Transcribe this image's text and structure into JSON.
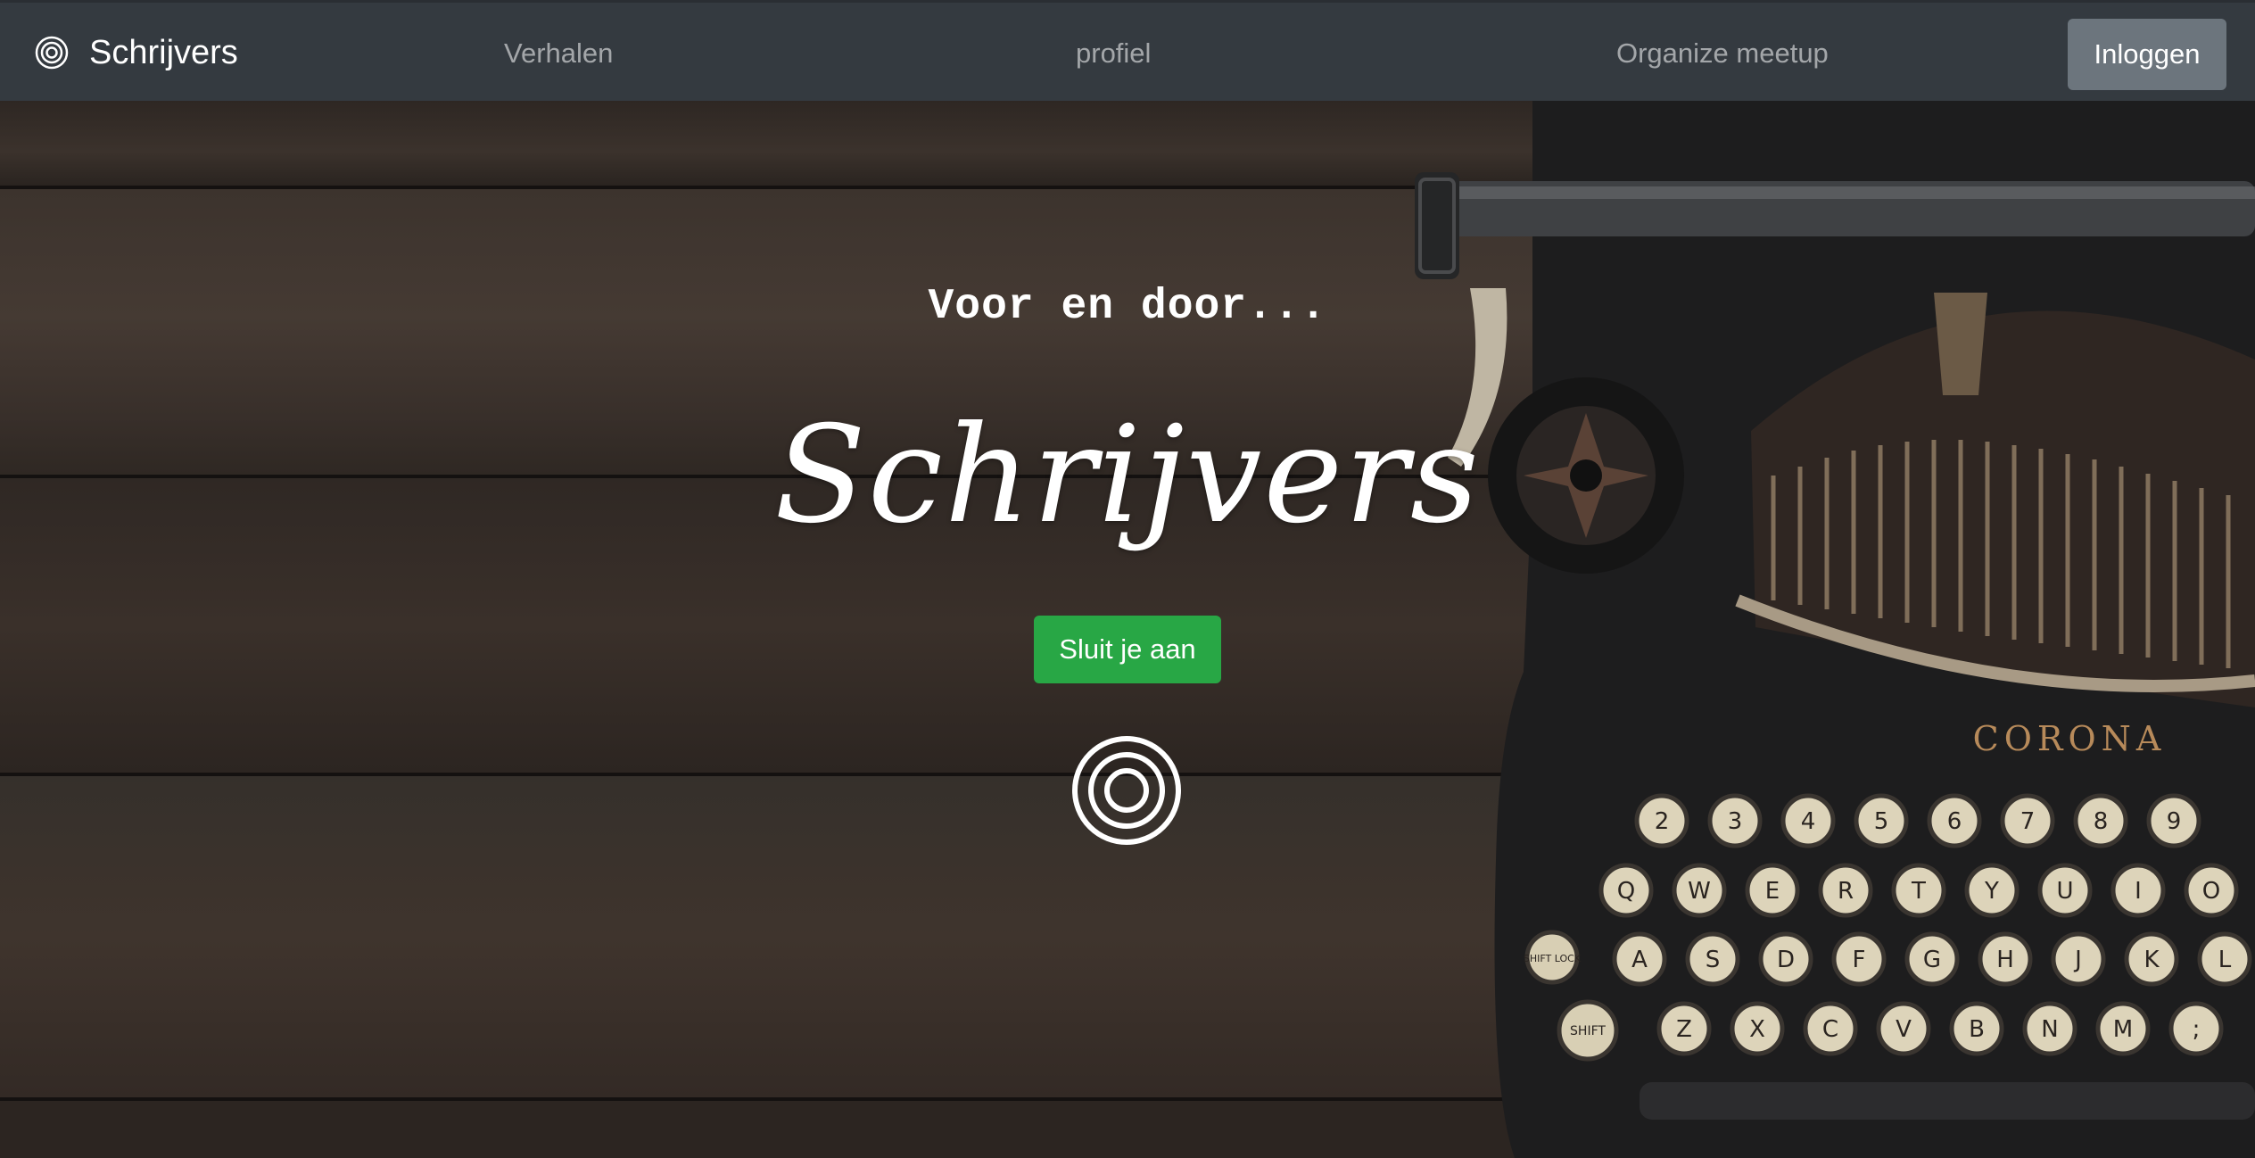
{
  "navbar": {
    "brand": "Schrijvers",
    "links": [
      "Verhalen",
      "profiel",
      "Organize meetup"
    ],
    "login_label": "Inloggen"
  },
  "hero": {
    "tagline": "Voor en door...",
    "title": "Schrijvers",
    "cta_label": "Sluit je aan",
    "typewriter_brand": "CORONA",
    "keys": {
      "number_row": [
        "2",
        "3",
        "4",
        "5",
        "6",
        "7",
        "8",
        "9"
      ],
      "top_row": [
        "Q",
        "W",
        "E",
        "R",
        "T",
        "Y",
        "U",
        "I",
        "O"
      ],
      "home_row": [
        "A",
        "S",
        "D",
        "F",
        "G",
        "H",
        "J",
        "K",
        "L"
      ],
      "bottom_row": [
        "Z",
        "X",
        "C",
        "V",
        "B",
        "N",
        "M",
        ";"
      ],
      "shift_lock": "SHIFT LOCK",
      "shift": "SHIFT"
    }
  },
  "colors": {
    "navbar_bg": "#343a40",
    "login_bg": "#6c757d",
    "cta_bg": "#28a745",
    "wood": "#3a312b"
  }
}
